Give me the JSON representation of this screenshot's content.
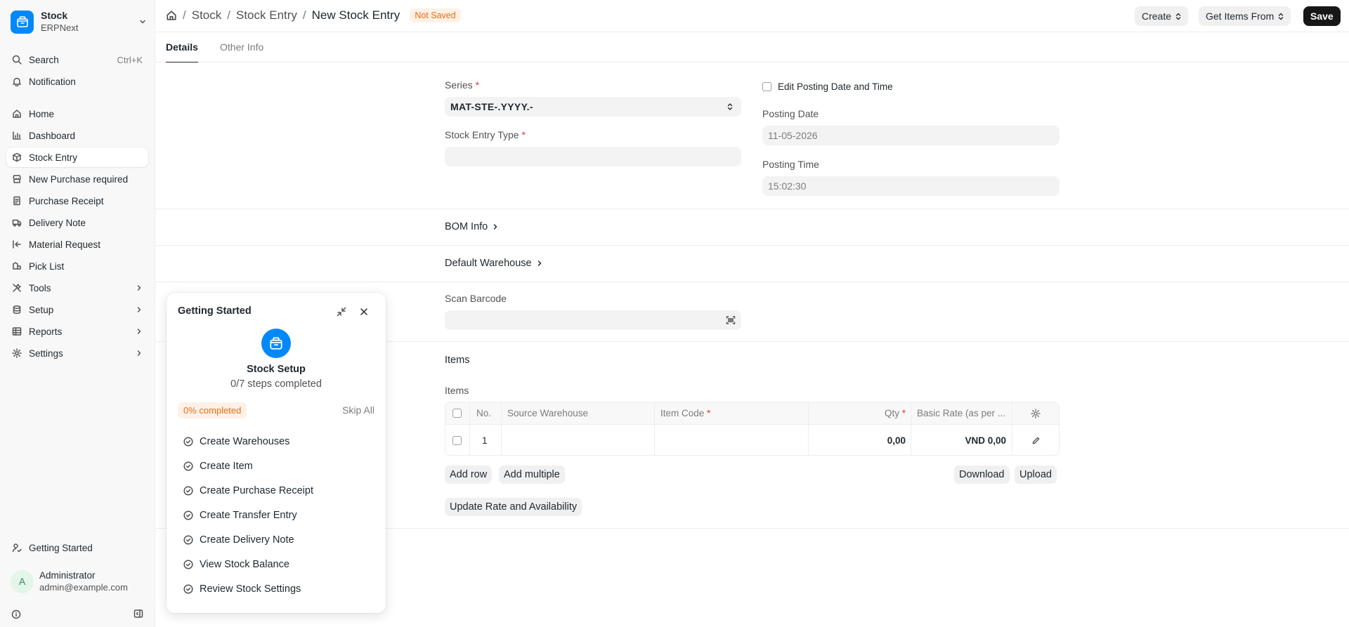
{
  "app": {
    "title": "Stock",
    "subtitle": "ERPNext"
  },
  "sidebar": {
    "search": {
      "label": "Search",
      "shortcut": "Ctrl+K"
    },
    "notification": "Notification",
    "items": [
      {
        "label": "Home",
        "icon": "home-icon"
      },
      {
        "label": "Dashboard",
        "icon": "chart-icon"
      },
      {
        "label": "Stock Entry",
        "icon": "box-icon",
        "active": true
      },
      {
        "label": "New Purchase required",
        "icon": "store-icon"
      },
      {
        "label": "Purchase Receipt",
        "icon": "receipt-icon"
      },
      {
        "label": "Delivery Note",
        "icon": "truck-icon"
      },
      {
        "label": "Material Request",
        "icon": "request-icon"
      },
      {
        "label": "Pick List",
        "icon": "list-icon"
      },
      {
        "label": "Tools",
        "icon": "tools-icon",
        "expandable": true
      },
      {
        "label": "Setup",
        "icon": "database-icon",
        "expandable": true
      },
      {
        "label": "Reports",
        "icon": "table-icon",
        "expandable": true
      },
      {
        "label": "Settings",
        "icon": "gear-icon",
        "expandable": true
      }
    ],
    "getting_started": "Getting Started",
    "user": {
      "initial": "A",
      "name": "Administrator",
      "email": "admin@example.com"
    }
  },
  "breadcrumb": {
    "items": [
      "Stock",
      "Stock Entry"
    ],
    "current": "New Stock Entry",
    "status": "Not Saved"
  },
  "toolbar": {
    "create": "Create",
    "get_items": "Get Items From",
    "save": "Save"
  },
  "tabs": [
    {
      "label": "Details",
      "active": true
    },
    {
      "label": "Other Info"
    }
  ],
  "form": {
    "series": {
      "label": "Series",
      "value": "MAT-STE-.YYYY.-"
    },
    "stock_entry_type": {
      "label": "Stock Entry Type",
      "value": ""
    },
    "edit_posting": {
      "label": "Edit Posting Date and Time",
      "checked": false
    },
    "posting_date": {
      "label": "Posting Date",
      "value": "11-05-2026"
    },
    "posting_time": {
      "label": "Posting Time",
      "value": "15:02:30"
    },
    "bom_info": "BOM Info",
    "default_warehouse": "Default Warehouse",
    "scan_barcode": {
      "label": "Scan Barcode",
      "value": ""
    },
    "items_section": "Items",
    "items_label": "Items"
  },
  "items_table": {
    "columns": [
      "No.",
      "Source Warehouse",
      "Item Code",
      "Qty",
      "Basic Rate (as per ..."
    ],
    "rows": [
      {
        "no": "1",
        "source_warehouse": "",
        "item_code": "",
        "qty": "0,00",
        "basic_rate": "VND 0,00"
      }
    ],
    "buttons": {
      "add_row": "Add row",
      "add_multiple": "Add multiple",
      "download": "Download",
      "upload": "Upload",
      "update_rate": "Update Rate and Availability"
    }
  },
  "getting_started": {
    "title": "Getting Started",
    "module": "Stock Setup",
    "steps_completed": "0/7 steps completed",
    "progress": "0% completed",
    "skip": "Skip All",
    "steps": [
      "Create Warehouses",
      "Create Item",
      "Create Purchase Receipt",
      "Create Transfer Entry",
      "Create Delivery Note",
      "View Stock Balance",
      "Review Stock Settings"
    ]
  }
}
